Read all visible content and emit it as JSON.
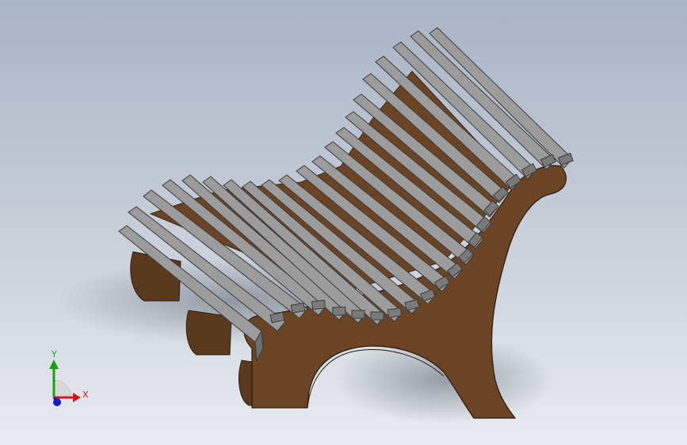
{
  "colors": {
    "slat_top": "#9c9c9c",
    "slat_side": "#6e6e6e",
    "slat_edge": "#3a3a3a",
    "wood": "#6a4425",
    "wood_dark": "#4a2f18",
    "shadow": "#6f7680",
    "axis_x": "#d01818",
    "axis_y": "#18a018",
    "axis_z": "#1818c8"
  },
  "triad": {
    "x_label": "X",
    "y_label": "Y"
  }
}
